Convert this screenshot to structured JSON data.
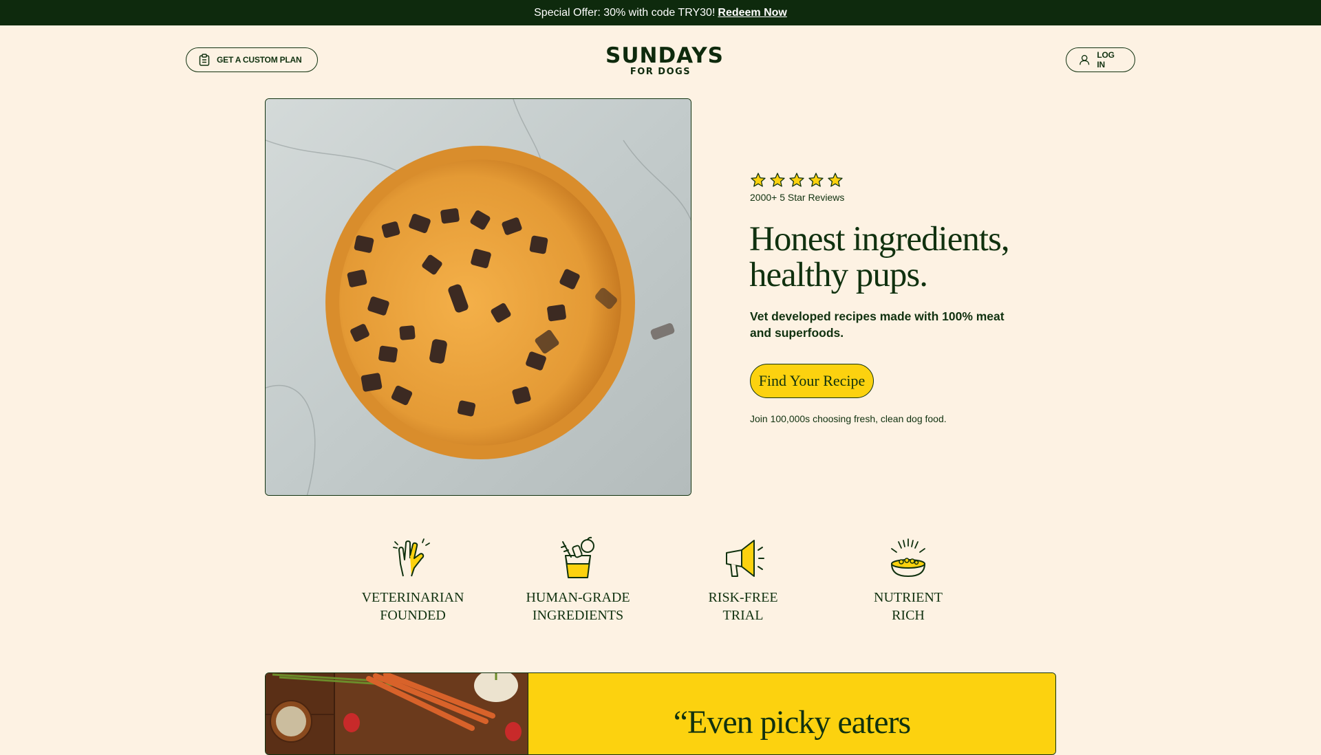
{
  "promo": {
    "text": "Special Offer: 30% with code TRY30!",
    "link": "Redeem Now"
  },
  "header": {
    "plan_button": "GET A CUSTOM PLAN",
    "logo_main": "SUNDAYS",
    "logo_sub": "FOR DOGS",
    "login_button": "LOG IN"
  },
  "hero": {
    "rating": 5,
    "rating_max": 5,
    "reviews": "2000+ 5 Star Reviews",
    "headline_line1": "Honest ingredients,",
    "headline_line2": "healthy pups.",
    "subhead": "Vet developed recipes made with 100% meat and superfoods.",
    "cta": "Find Your Recipe",
    "join_text": "Join 100,000s choosing fresh, clean dog food."
  },
  "features": [
    {
      "line1": "VETERINARIAN",
      "line2": "FOUNDED",
      "icon": "high-five-icon"
    },
    {
      "line1": "HUMAN-GRADE",
      "line2": "INGREDIENTS",
      "icon": "groceries-icon"
    },
    {
      "line1": "RISK-FREE",
      "line2": "TRIAL",
      "icon": "megaphone-icon"
    },
    {
      "line1": "NUTRIENT",
      "line2": "RICH",
      "icon": "food-bowl-icon"
    }
  ],
  "testimonial": {
    "quote": "“Even picky eaters"
  },
  "colors": {
    "background": "#fdf2e3",
    "dark_green": "#10310f",
    "promo_bar": "#0e2a0d",
    "yellow": "#fcd20f",
    "bowl_orange": "#e8962e"
  }
}
